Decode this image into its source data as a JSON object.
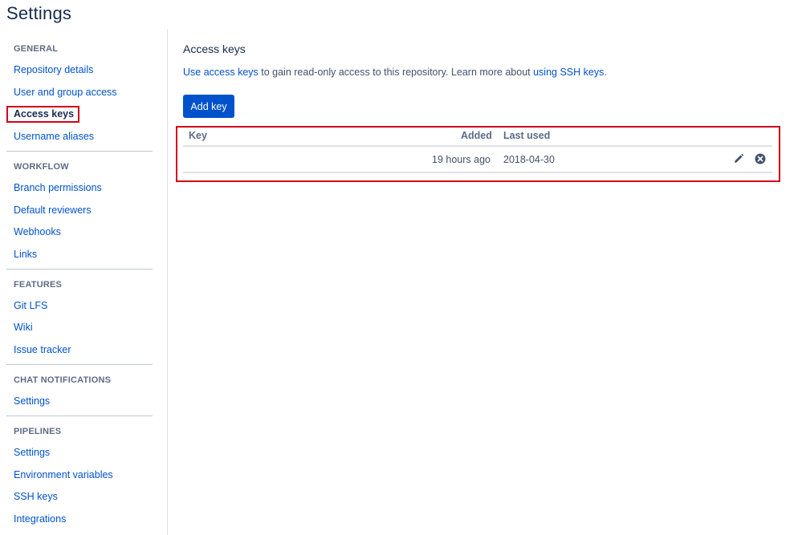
{
  "page": {
    "title": "Settings"
  },
  "sidebar": {
    "sections": [
      {
        "heading": "GENERAL",
        "items": [
          {
            "label": "Repository details"
          },
          {
            "label": "User and group access"
          },
          {
            "label": "Access keys",
            "active": true
          },
          {
            "label": "Username aliases"
          }
        ]
      },
      {
        "heading": "WORKFLOW",
        "items": [
          {
            "label": "Branch permissions"
          },
          {
            "label": "Default reviewers"
          },
          {
            "label": "Webhooks"
          },
          {
            "label": "Links"
          }
        ]
      },
      {
        "heading": "FEATURES",
        "items": [
          {
            "label": "Git LFS"
          },
          {
            "label": "Wiki"
          },
          {
            "label": "Issue tracker"
          }
        ]
      },
      {
        "heading": "CHAT NOTIFICATIONS",
        "items": [
          {
            "label": "Settings"
          }
        ]
      },
      {
        "heading": "PIPELINES",
        "items": [
          {
            "label": "Settings"
          },
          {
            "label": "Environment variables"
          },
          {
            "label": "SSH keys"
          },
          {
            "label": "Integrations"
          }
        ]
      }
    ]
  },
  "main": {
    "heading": "Access keys",
    "intro": {
      "link1": "Use access keys",
      "text1": " to gain read-only access to this repository. Learn more about ",
      "link2": "using SSH keys",
      "text2": "."
    },
    "add_button": "Add key",
    "table": {
      "headers": {
        "key": "Key",
        "added": "Added",
        "last_used": "Last used"
      },
      "rows": [
        {
          "key": "",
          "added": "19 hours ago",
          "last_used": "2018-04-30",
          "actions": [
            "pencil-icon",
            "remove-circle-icon"
          ]
        }
      ]
    }
  },
  "colors": {
    "link": "#0052cc",
    "button": "#0052cc",
    "highlight": "#d0021b",
    "heading": "#5e6c84"
  }
}
